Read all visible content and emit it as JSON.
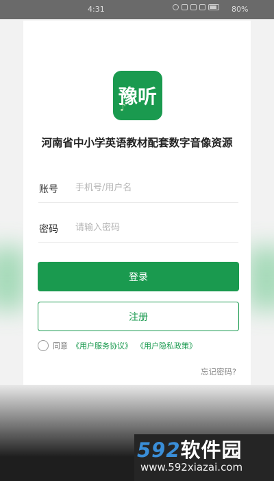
{
  "status_bar": {
    "time": "4:31",
    "battery": "80%"
  },
  "logo": {
    "text": "豫听",
    "note": "♪"
  },
  "app_title": "河南省中小学英语教材配套数字音像资源",
  "form": {
    "account_label": "账号",
    "account_placeholder": "手机号/用户名",
    "password_label": "密码",
    "password_placeholder": "请输入密码"
  },
  "buttons": {
    "login": "登录",
    "register": "注册"
  },
  "agreement": {
    "prefix": "同意",
    "terms": "《用户服务协议》",
    "privacy": "《用户隐私政策》",
    "checked": false
  },
  "forgot_password": "忘记密码?",
  "watermark": {
    "brand_num": "592",
    "brand_cn": "软件园",
    "url": "www.592xiazai.com"
  },
  "colors": {
    "accent": "#1a9a4f"
  }
}
